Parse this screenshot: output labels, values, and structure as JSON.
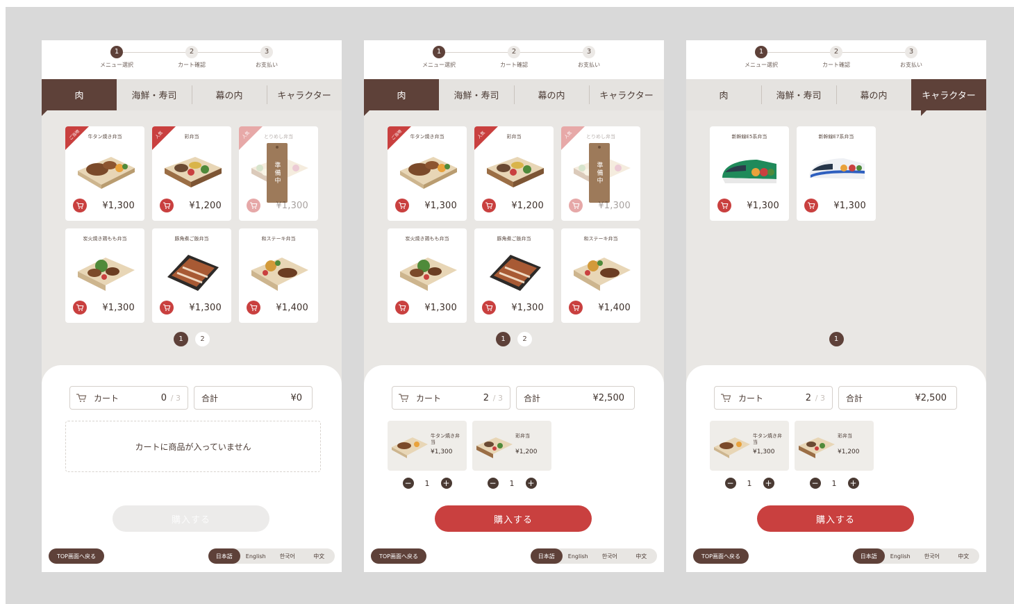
{
  "steps": [
    {
      "num": "1",
      "label": "メニュー選択"
    },
    {
      "num": "2",
      "label": "カート確認"
    },
    {
      "num": "3",
      "label": "お支払い"
    }
  ],
  "tabs": [
    "肉",
    "海鮮・寿司",
    "幕の内",
    "キャラクター"
  ],
  "products_meat": [
    {
      "name": "牛タン焼き弁当",
      "price": "¥1,300",
      "ribbon": "ご当地"
    },
    {
      "name": "彩弁当",
      "price": "¥1,200",
      "ribbon": "人気"
    },
    {
      "name": "とりめし弁当",
      "price": "¥1,300",
      "ribbon": "人気",
      "status": "準備中"
    },
    {
      "name": "炭火焼き鶏もも弁当",
      "price": "¥1,300"
    },
    {
      "name": "豚角煮ご飯弁当",
      "price": "¥1,300"
    },
    {
      "name": "和ステーキ弁当",
      "price": "¥1,400"
    }
  ],
  "products_character": [
    {
      "name": "新幹線E5系弁当",
      "price": "¥1,300"
    },
    {
      "name": "新幹線E7系弁当",
      "price": "¥1,300"
    }
  ],
  "pages": [
    "1",
    "2"
  ],
  "pages_single": [
    "1"
  ],
  "cart": {
    "label": "カート",
    "max": "3",
    "total_label": "合計",
    "empty_count": "0",
    "empty_total": "¥0",
    "filled_count": "2",
    "filled_total": "¥2,500",
    "empty_message": "カートに商品が入っていません",
    "items": [
      {
        "name": "牛タン焼き弁当",
        "price": "¥1,300",
        "qty": "1"
      },
      {
        "name": "彩弁当",
        "price": "¥1,200",
        "qty": "1"
      }
    ]
  },
  "qty_minus": "−",
  "qty_plus": "+",
  "buy_label": "購入する",
  "top_label": "TOP画面へ戻る",
  "languages": [
    "日本語",
    "English",
    "한국어",
    "中文"
  ],
  "colors": {
    "brand": "#5e4139",
    "accent": "#c9403f",
    "bg": "#e9e7e4"
  }
}
